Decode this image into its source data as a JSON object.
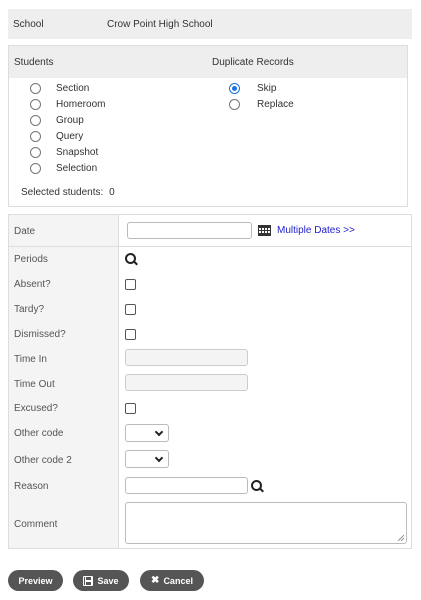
{
  "school": {
    "label": "School",
    "value": "Crow Point High School"
  },
  "students": {
    "heading": "Students",
    "options": [
      "Section",
      "Homeroom",
      "Group",
      "Query",
      "Snapshot",
      "Selection"
    ],
    "selected_label": "Selected students:",
    "selected_count": "0"
  },
  "duplicates": {
    "heading": "Duplicate Records",
    "options": [
      "Skip",
      "Replace"
    ],
    "selected": "Skip"
  },
  "form": {
    "date_label": "Date",
    "date_value": "",
    "multiple_dates_link": "Multiple Dates >>",
    "periods_label": "Periods",
    "absent_label": "Absent?",
    "tardy_label": "Tardy?",
    "dismissed_label": "Dismissed?",
    "time_in_label": "Time In",
    "time_out_label": "Time Out",
    "excused_label": "Excused?",
    "other_code_label": "Other code",
    "other_code2_label": "Other code 2",
    "reason_label": "Reason",
    "comment_label": "Comment"
  },
  "buttons": {
    "preview": "Preview",
    "save": "Save",
    "cancel": "Cancel"
  },
  "colors": {
    "accent_radio": "#1a73e8",
    "link": "#2222cc",
    "button_bg": "#555555"
  }
}
